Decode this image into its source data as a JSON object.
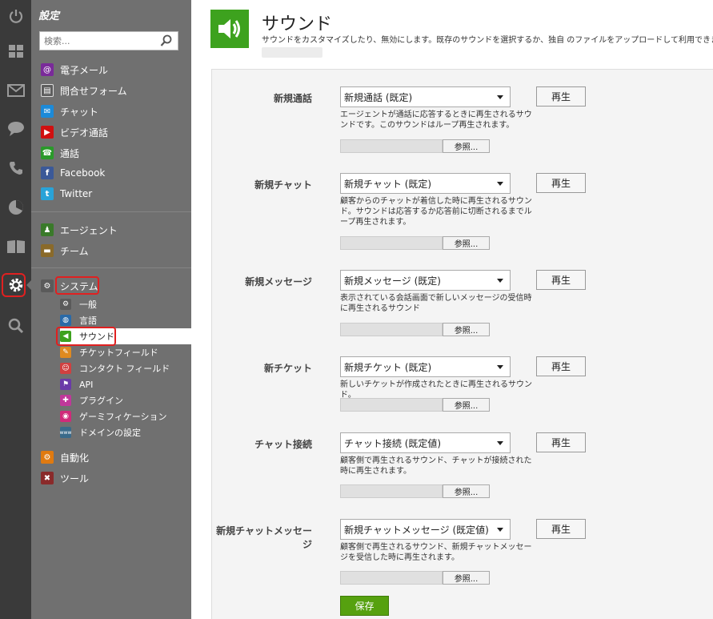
{
  "rail": {
    "items": [
      {
        "name": "power"
      },
      {
        "name": "dashboard"
      },
      {
        "name": "email"
      },
      {
        "name": "chat"
      },
      {
        "name": "phone"
      },
      {
        "name": "reports"
      },
      {
        "name": "knowledgebase"
      },
      {
        "name": "settings",
        "active": true
      },
      {
        "name": "search"
      }
    ]
  },
  "sidebar": {
    "title": "設定",
    "search_placeholder": "検索...",
    "channels": [
      {
        "label": "電子メール",
        "icon": "email-icon",
        "color": "#7a2a9a",
        "glyph": "@"
      },
      {
        "label": "問合せフォーム",
        "icon": "form-icon",
        "color": "#6a6a6a",
        "glyph": "▤"
      },
      {
        "label": "チャット",
        "icon": "chat-icon",
        "color": "#1c8ad8",
        "glyph": "✉"
      },
      {
        "label": "ビデオ通話",
        "icon": "video-icon",
        "color": "#d01010",
        "glyph": "▶"
      },
      {
        "label": "通話",
        "icon": "phone-icon",
        "color": "#2a9a2a",
        "glyph": "☎"
      },
      {
        "label": "Facebook",
        "icon": "facebook-icon",
        "color": "#3b5998",
        "glyph": "f"
      },
      {
        "label": "Twitter",
        "icon": "twitter-icon",
        "color": "#29a3d8",
        "glyph": "t"
      }
    ],
    "people": [
      {
        "label": "エージェント",
        "icon": "agents-icon",
        "color": "#3a7a2a",
        "glyph": "👥"
      },
      {
        "label": "チーム",
        "icon": "team-icon",
        "color": "#8a6a2a",
        "glyph": "▬"
      }
    ],
    "system": {
      "label": "システム",
      "icon": "gear-icon"
    },
    "system_items": [
      {
        "label": "一般",
        "icon": "general-icon",
        "color": "#5a5a5a",
        "glyph": "⚙"
      },
      {
        "label": "言語",
        "icon": "language-icon",
        "color": "#2a6aa8",
        "glyph": "◍"
      },
      {
        "label": "サウンド",
        "icon": "sound-icon",
        "color": "#3da21e",
        "glyph": "◀",
        "active": true
      },
      {
        "label": "チケットフィールド",
        "icon": "ticket-fields-icon",
        "color": "#e08a20",
        "glyph": "✎"
      },
      {
        "label": "コンタクト フィールド",
        "icon": "contact-fields-icon",
        "color": "#d04040",
        "glyph": "☺"
      },
      {
        "label": "API",
        "icon": "api-icon",
        "color": "#6a3aa8",
        "glyph": "⚑"
      },
      {
        "label": "プラグイン",
        "icon": "plugin-icon",
        "color": "#c0389a",
        "glyph": "✚"
      },
      {
        "label": "ゲーミフィケーション",
        "icon": "gamification-icon",
        "color": "#d02a7a",
        "glyph": "◉"
      },
      {
        "label": "ドメインの設定",
        "icon": "domain-icon",
        "color": "#3a6a8a",
        "glyph": "www"
      }
    ],
    "bottom": [
      {
        "label": "自動化",
        "icon": "automation-icon",
        "color": "#e07a10",
        "glyph": "⚙"
      },
      {
        "label": "ツール",
        "icon": "tools-icon",
        "color": "#8a2a2a",
        "glyph": "✖"
      }
    ]
  },
  "main": {
    "title": "サウンド",
    "description": "サウンドをカスタマイズしたり、無効にします。既存のサウンドを選択するか、独自 のファイルをアップロードして利用できます。",
    "play_label": "再生",
    "browse_label": "参照...",
    "save_label": "保存",
    "rows": [
      {
        "label": "新規通話",
        "selected": "新規通話 (既定)",
        "help": "エージェントが通話に応答するときに再生されるサウンドです。このサウンドはループ再生されます。"
      },
      {
        "label": "新規チャット",
        "selected": "新規チャット (既定)",
        "help": "顧客からのチャットが着信した時に再生されるサウンド。サウンドは応答するか応答前に切断されるまでループ再生されます。"
      },
      {
        "label": "新規メッセージ",
        "selected": "新規メッセージ (既定)",
        "help": "表示されている会話画面で新しいメッセージの受信時に再生されるサウンド"
      },
      {
        "label": "新チケット",
        "selected": "新規チケット (既定)",
        "help": "新しいチケットが作成されたときに再生されるサウンド。"
      },
      {
        "label": "チャット接続",
        "selected": "チャット接続 (既定値)",
        "help": "顧客側で再生されるサウンド、チャットが接続された時に再生されます。"
      },
      {
        "label": "新規チャットメッセージ",
        "selected": "新規チャットメッセージ (既定値)",
        "help": "顧客側で再生されるサウンド、新規チャットメッセージを受信した時に再生されます。"
      }
    ]
  }
}
